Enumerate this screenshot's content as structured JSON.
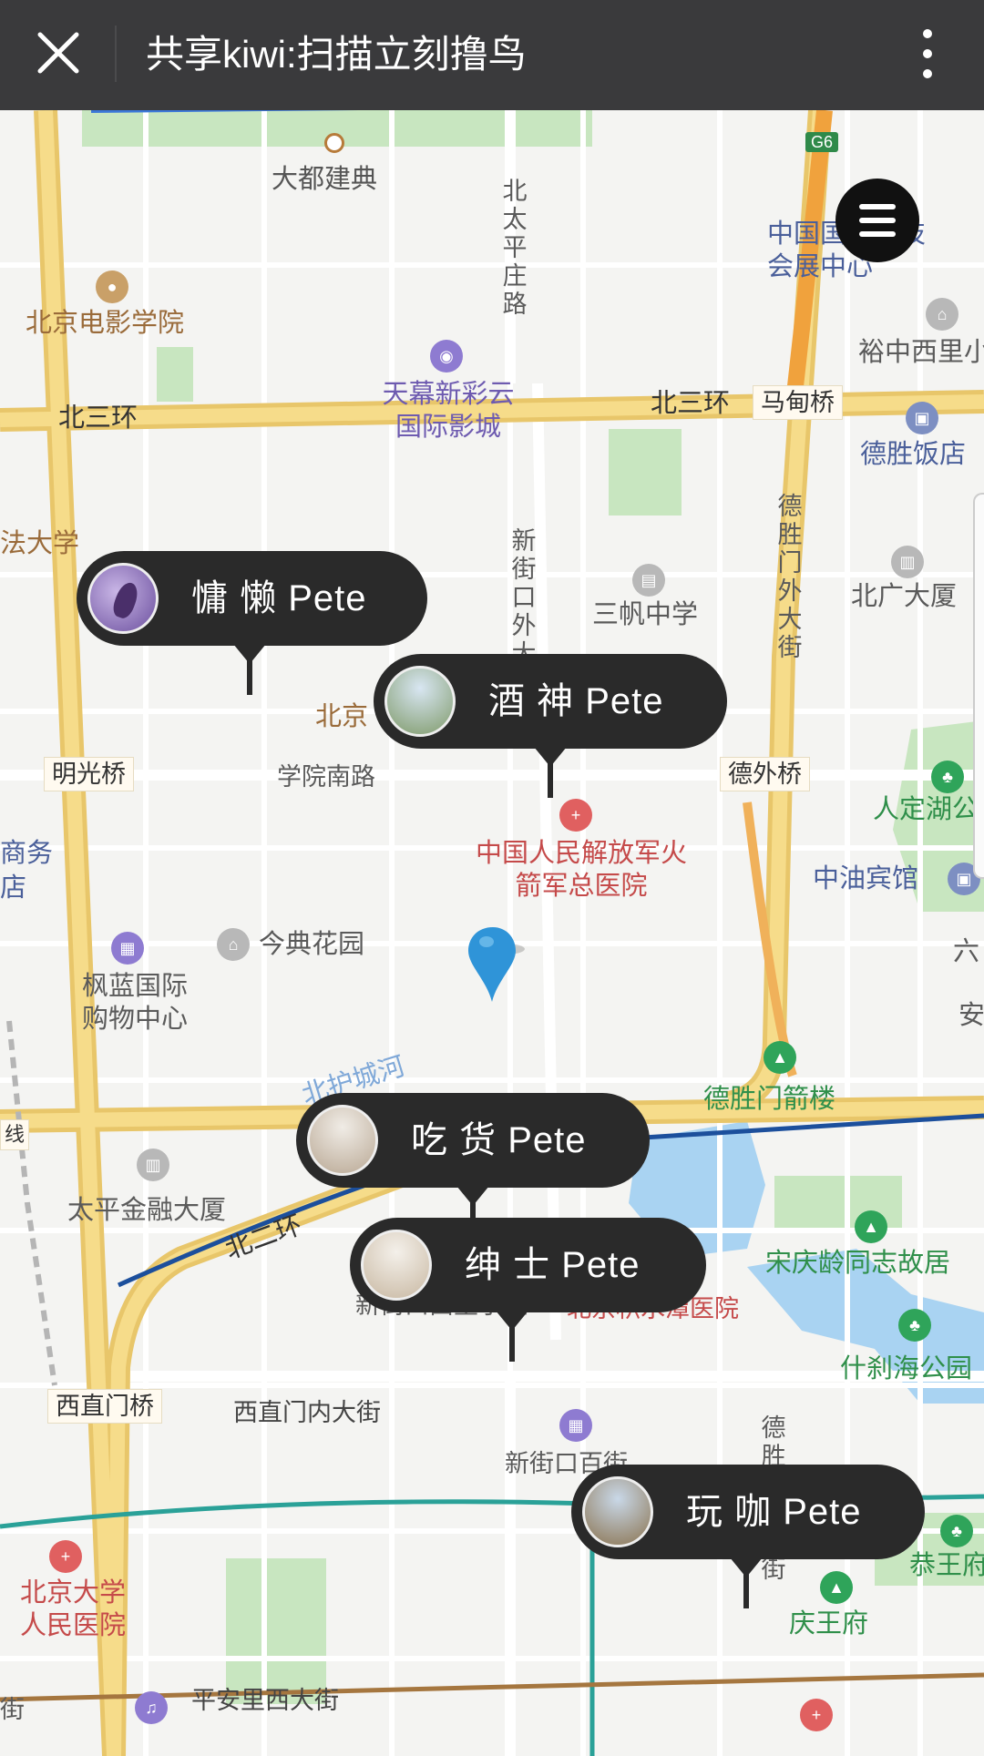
{
  "topbar": {
    "title": "共享kiwi:扫描立刻撸鸟",
    "close_icon": "close-icon",
    "more_icon": "more-vertical-icon"
  },
  "map": {
    "menu_icon": "hamburger-menu-icon",
    "labels": {
      "dadu": "大都建典",
      "beitaipinzhuang": "北太平庄路",
      "filmacademy": "北京电影学院",
      "zhongguo_tech": "中国国际科技会展中心",
      "yuzhong": "裕中西里小",
      "tianmu": "天幕新彩云国际影城",
      "beisanhuan_w": "北三环",
      "beisanhuan_e": "北三环",
      "madianqiao": "马甸桥",
      "deshengfandian": "德胜饭店",
      "fadaxue": "法大学",
      "xinjiekouwai": "新街口外大街",
      "sanfan": "三帆中学",
      "deshengmenwai": "德胜门外大街",
      "beiguang": "北广大厦",
      "beijing_part": "北京",
      "mingguangqiao": "明光桥",
      "xueyuannan": "学院南路",
      "dewaiqiao": "德外桥",
      "rendinghu": "人定湖公",
      "shangwu": "商务",
      "dian": "店",
      "hospital": "中国人民解放军火箭军总医院",
      "zhongyou": "中油宾馆",
      "jindian": "今典花园",
      "fenglan": "枫蓝国际购物中心",
      "liu": "六",
      "an": "安",
      "beihuchenghe": "北护城河",
      "deshengmenjianlou": "德胜门箭楼",
      "xian": "线",
      "taiping": "太平金融大厦",
      "beierhuan": "北二环",
      "songqingling": "宋庆龄同志故居",
      "xinjiekou_xili": "新街口西里小区",
      "jishuitan": "北京积水潭医院",
      "shichahai": "什刹海公园",
      "xizhimenqiao": "西直门桥",
      "xizhimennei": "西直门内大街",
      "xinjiekou_dajie": "新街口百街",
      "deshengmennei": "德胜门内大街",
      "gongwangfu": "恭王府",
      "pku_hospital": "北京大学人民医院",
      "qingwangfu": "庆王府",
      "pinganli": "平安里西大街",
      "jie": "街",
      "g6": "G6"
    },
    "bubbles": [
      {
        "name": "慵 懒  Pete"
      },
      {
        "name": "酒 神  Pete"
      },
      {
        "name": "吃 货  Pete"
      },
      {
        "name": "绅 士  Pete"
      },
      {
        "name": "玩 咖  Pete"
      }
    ],
    "location_pin_icon": "location-pin-icon"
  }
}
